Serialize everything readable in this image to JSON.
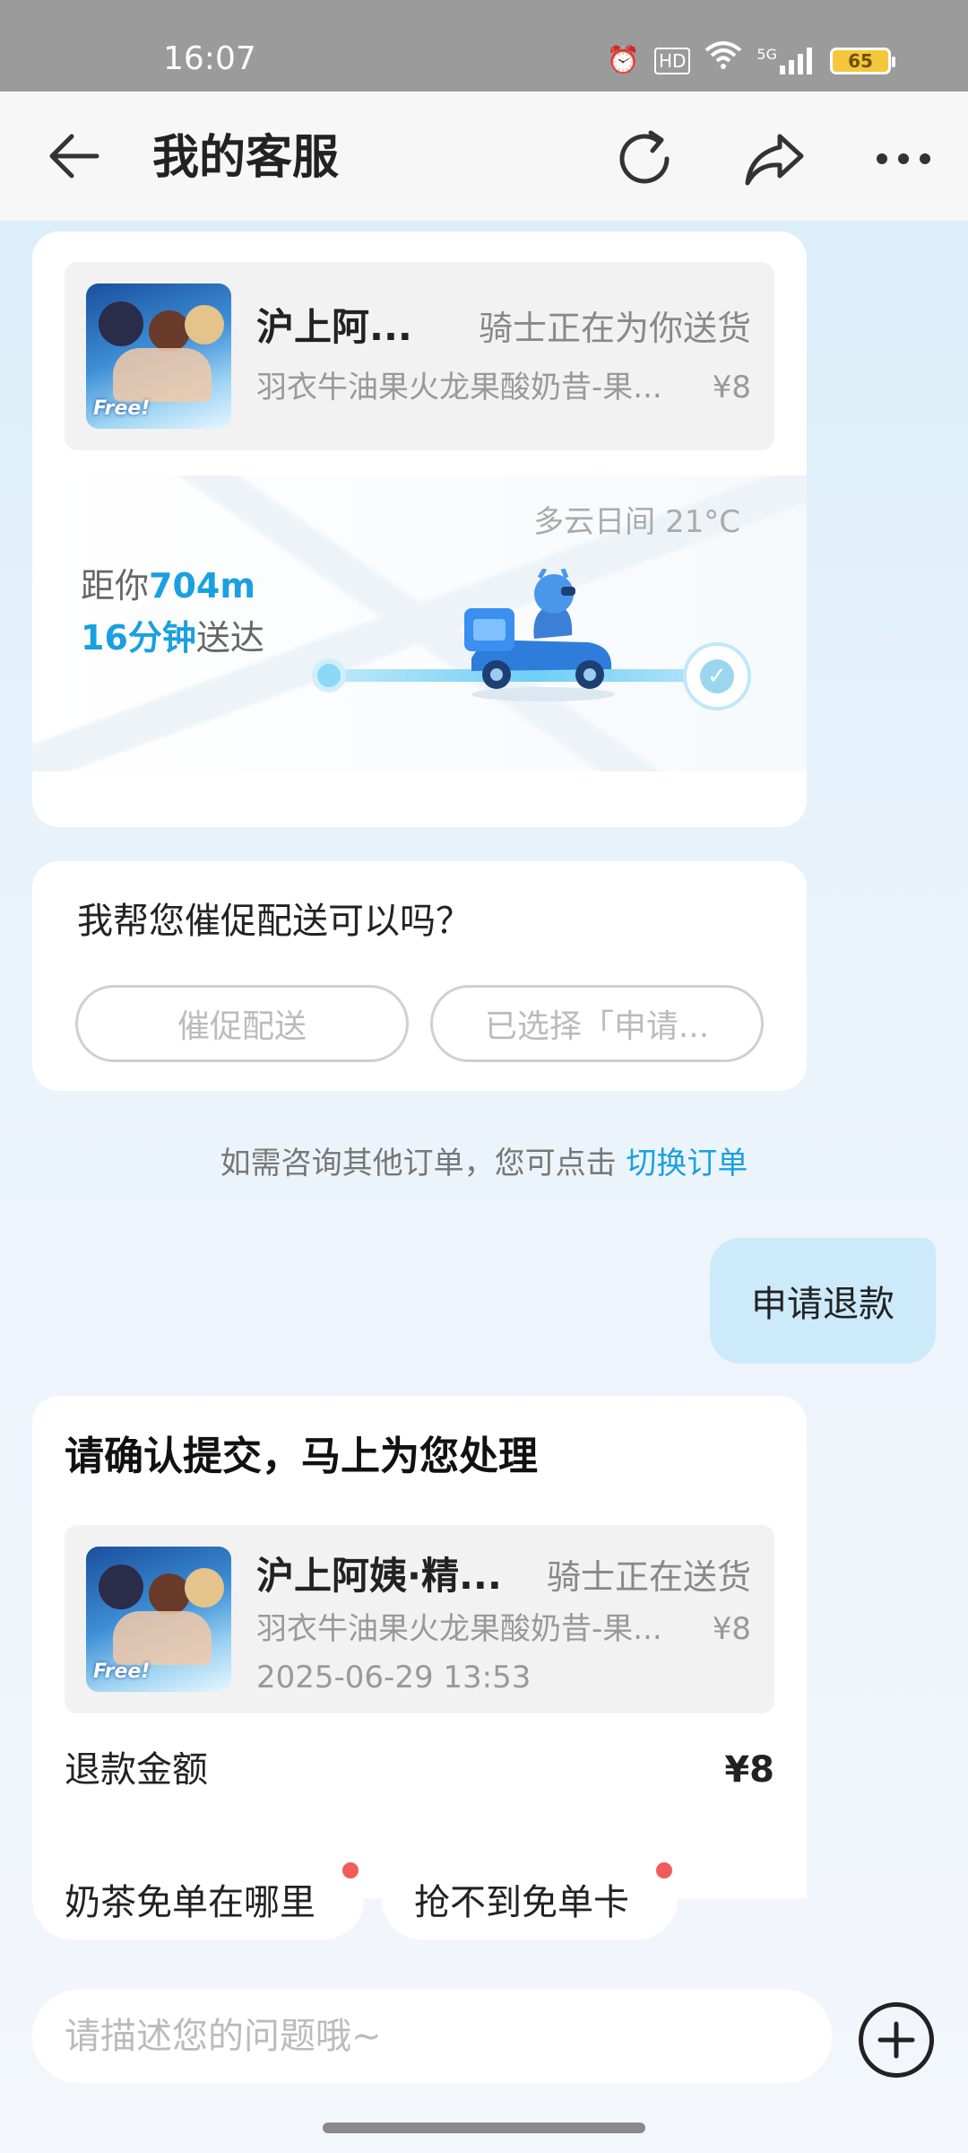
{
  "status_bar": {
    "time": "16:07",
    "hd": "HD",
    "network": "5G",
    "battery": "65"
  },
  "header": {
    "title": "我的客服"
  },
  "order_card": {
    "shop_name": "沪上阿...",
    "status": "骑士正在为你送货",
    "item_name": "羽衣牛油果火龙果酸奶昔-果...",
    "price": "¥8",
    "thumb_text": "Free!",
    "weather": "多云日间 21°C",
    "distance_prefix": "距你",
    "distance_value": "704m",
    "eta_value": "16分钟",
    "eta_suffix": "送达"
  },
  "ask_card": {
    "question": "我帮您催促配送可以吗？",
    "option_1": "催促配送",
    "option_2": "已选择「申请..."
  },
  "switch_tip": {
    "text": "如需咨询其他订单，您可点击",
    "link": "切换订单"
  },
  "user_message": "申请退款",
  "confirm_card": {
    "title": "请确认提交，马上为您处理",
    "shop_name": "沪上阿姨·精...",
    "status": "骑士正在送货",
    "item_name": "羽衣牛油果火龙果酸奶昔-果...",
    "price": "¥8",
    "order_time": "2025-06-29 13:53",
    "refund_label": "退款金额",
    "refund_value": "¥8"
  },
  "quick_chips": [
    {
      "label": "奶茶免单在哪里"
    },
    {
      "label": "抢不到免单卡"
    }
  ],
  "input": {
    "placeholder": "请描述您的问题哦~"
  },
  "colors": {
    "accent": "#1aa0e0",
    "bubble": "#cdeafb",
    "badge_dot": "#f15b5b"
  }
}
